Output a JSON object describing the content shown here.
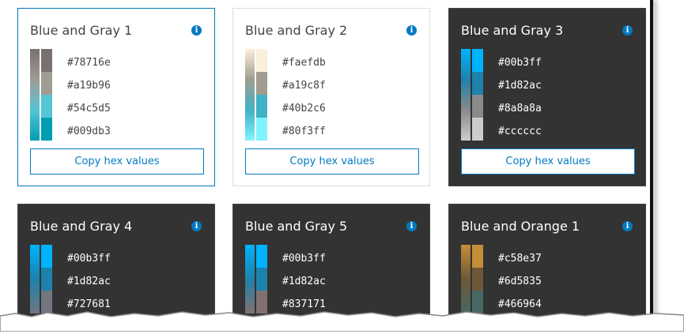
{
  "accent": "#0079c1",
  "copy_label": "Copy hex values",
  "cards": [
    {
      "title": "Blue and Gray 1",
      "theme": "light",
      "selected": true,
      "colors": [
        "#78716e",
        "#a19b96",
        "#54c5d5",
        "#009db3"
      ]
    },
    {
      "title": "Blue and Gray 2",
      "theme": "light",
      "selected": false,
      "colors": [
        "#faefdb",
        "#a19c8f",
        "#40b2c6",
        "#80f3ff"
      ]
    },
    {
      "title": "Blue and Gray 3",
      "theme": "dark",
      "selected": false,
      "colors": [
        "#00b3ff",
        "#1d82ac",
        "#8a8a8a",
        "#cccccc"
      ]
    },
    {
      "title": "Blue and Gray 4",
      "theme": "dark",
      "selected": false,
      "colors": [
        "#00b3ff",
        "#1d82ac",
        "#727681"
      ]
    },
    {
      "title": "Blue and Gray 5",
      "theme": "dark",
      "selected": false,
      "colors": [
        "#00b3ff",
        "#1d82ac",
        "#837171"
      ]
    },
    {
      "title": "Blue and Orange 1",
      "theme": "dark",
      "selected": false,
      "colors": [
        "#c58e37",
        "#6d5835",
        "#466964"
      ]
    }
  ]
}
